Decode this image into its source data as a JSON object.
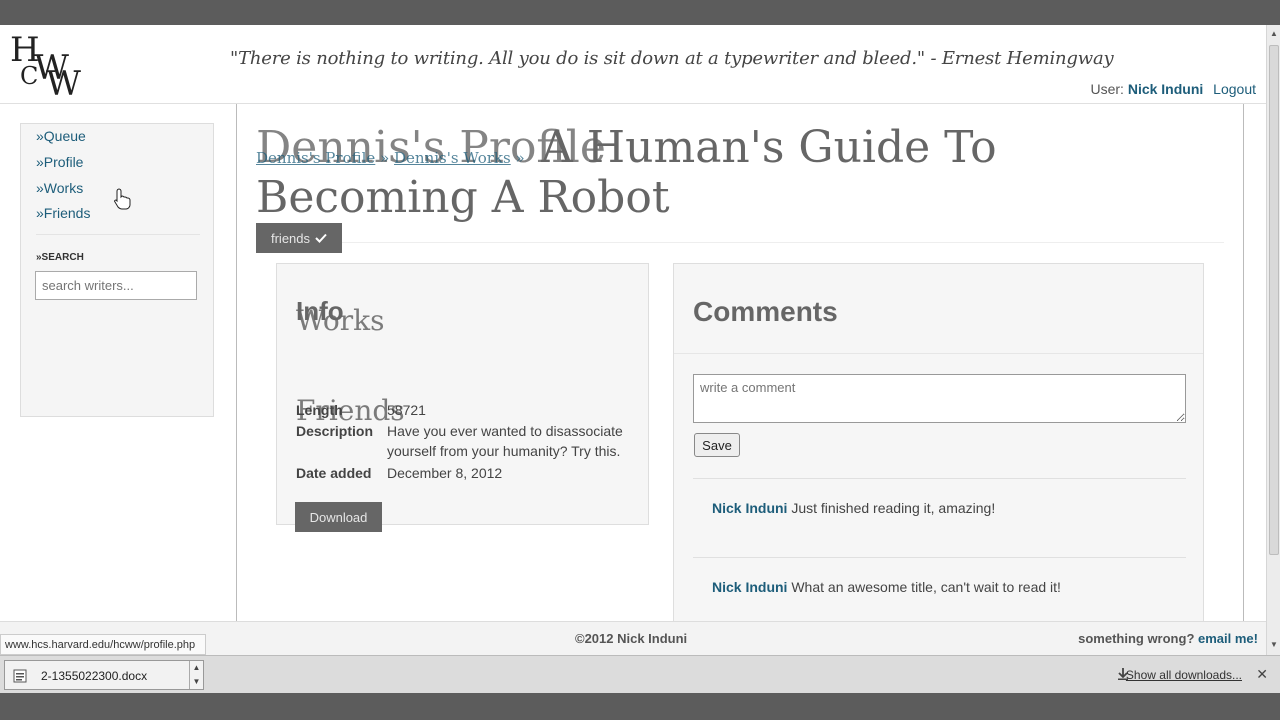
{
  "header": {
    "logo_letters": [
      "H",
      "C",
      "W",
      "W"
    ],
    "quote": "\"There is nothing to writing. All you do is sit down at a typewriter and bleed.\" - Ernest Hemingway",
    "user_label": "User:",
    "user_name": "Nick Induni",
    "logout": "Logout"
  },
  "sidebar": {
    "items": [
      {
        "label": "»Queue"
      },
      {
        "label": "»Profile"
      },
      {
        "label": "»Works"
      },
      {
        "label": "»Friends"
      }
    ],
    "search_label": "»SEARCH",
    "search_placeholder": "search writers..."
  },
  "main": {
    "title": "A Human's Guide To Becoming A Robot",
    "ghost_title": "Dennis's Profile",
    "breadcrumb": {
      "first": "Dennis's Profile",
      "sep1": " » ",
      "second": "Dennis's Works",
      "sep2": " »"
    },
    "friends_button": "friends",
    "info": {
      "heading": "Info",
      "ghost_works": "Works",
      "ghost_friends": "Friends",
      "rows": [
        {
          "label": "Length",
          "value": "58721"
        },
        {
          "label": "Description",
          "value": "Have you ever wanted to disassociate yourself from your humanity? Try this."
        },
        {
          "label": "Date added",
          "value": "December 8, 2012"
        }
      ],
      "download_button": "Download"
    },
    "comments": {
      "heading": "Comments",
      "input_placeholder": "write a comment",
      "save_button": "Save",
      "items": [
        {
          "author": "Nick Induni",
          "text": "Just finished reading it, amazing!"
        },
        {
          "author": "Nick Induni",
          "text": "What an awesome title, can't wait to read it!"
        }
      ]
    }
  },
  "footer": {
    "copyright": "©2012 Nick Induni",
    "report_text": "something wrong?",
    "report_link": "email me!"
  },
  "status_url": "www.hcs.harvard.edu/hcww/profile.php",
  "download_shelf": {
    "file_name": "2-1355022300.docx",
    "show_all": "Show all downloads..."
  },
  "colors": {
    "link": "#1d5d7a",
    "button": "#666666",
    "panel_bg": "#f6f6f6"
  }
}
